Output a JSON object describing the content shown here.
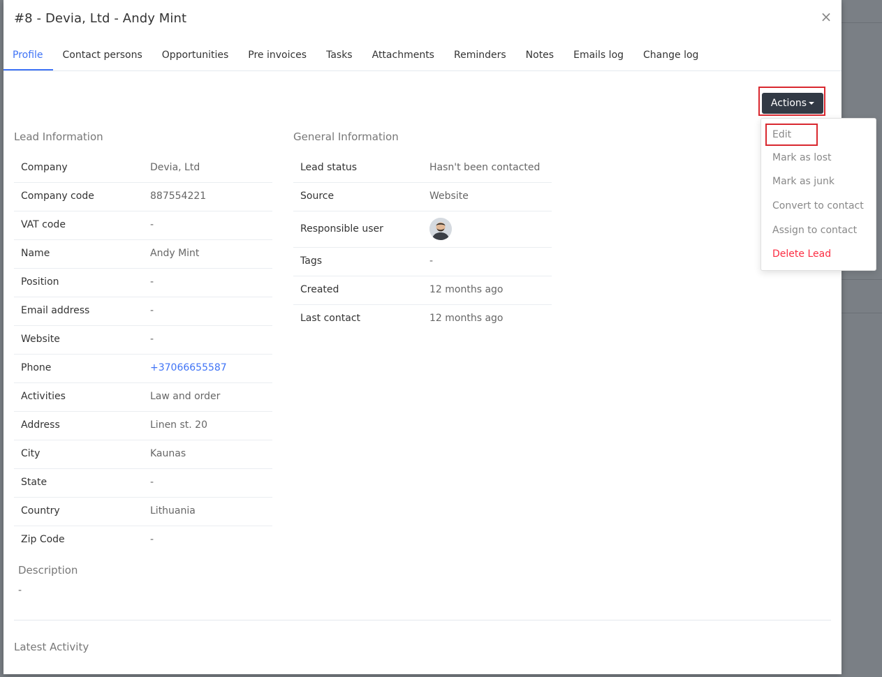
{
  "modal": {
    "title": "#8 - Devia, Ltd - Andy Mint",
    "close_icon": "×"
  },
  "tabs": [
    {
      "label": "Profile",
      "active": true
    },
    {
      "label": "Contact persons"
    },
    {
      "label": "Opportunities"
    },
    {
      "label": "Pre invoices"
    },
    {
      "label": "Tasks"
    },
    {
      "label": "Attachments"
    },
    {
      "label": "Reminders"
    },
    {
      "label": "Notes"
    },
    {
      "label": "Emails log"
    },
    {
      "label": "Change log"
    }
  ],
  "actions": {
    "label": "Actions",
    "menu": [
      {
        "label": "Edit"
      },
      {
        "label": "Mark as lost"
      },
      {
        "label": "Mark as junk"
      },
      {
        "label": "Convert to contact"
      },
      {
        "label": "Assign to contact"
      },
      {
        "label": "Delete Lead",
        "danger": true
      }
    ]
  },
  "lead_info": {
    "title": "Lead Information",
    "rows": [
      {
        "label": "Company",
        "value": "Devia, Ltd"
      },
      {
        "label": "Company code",
        "value": "887554221"
      },
      {
        "label": "VAT code",
        "value": "-"
      },
      {
        "label": "Name",
        "value": "Andy Mint"
      },
      {
        "label": "Position",
        "value": "-"
      },
      {
        "label": "Email address",
        "value": "-"
      },
      {
        "label": "Website",
        "value": "-"
      },
      {
        "label": "Phone",
        "value": "+37066655587"
      },
      {
        "label": "Activities",
        "value": "Law and order"
      },
      {
        "label": "Address",
        "value": "Linen st. 20"
      },
      {
        "label": "City",
        "value": "Kaunas"
      },
      {
        "label": "State",
        "value": "-"
      },
      {
        "label": "Country",
        "value": "Lithuania"
      },
      {
        "label": "Zip Code",
        "value": "-"
      }
    ]
  },
  "general_info": {
    "title": "General Information",
    "rows": [
      {
        "label": "Lead status",
        "value": "Hasn't been contacted"
      },
      {
        "label": "Source",
        "value": "Website"
      },
      {
        "label": "Responsible user",
        "value": ""
      },
      {
        "label": "Tags",
        "value": "-"
      },
      {
        "label": "Created",
        "value": "12 months ago"
      },
      {
        "label": "Last contact",
        "value": "12 months ago"
      }
    ]
  },
  "description": {
    "title": "Description",
    "value": "-"
  },
  "latest_activity": {
    "title": "Latest Activity"
  }
}
